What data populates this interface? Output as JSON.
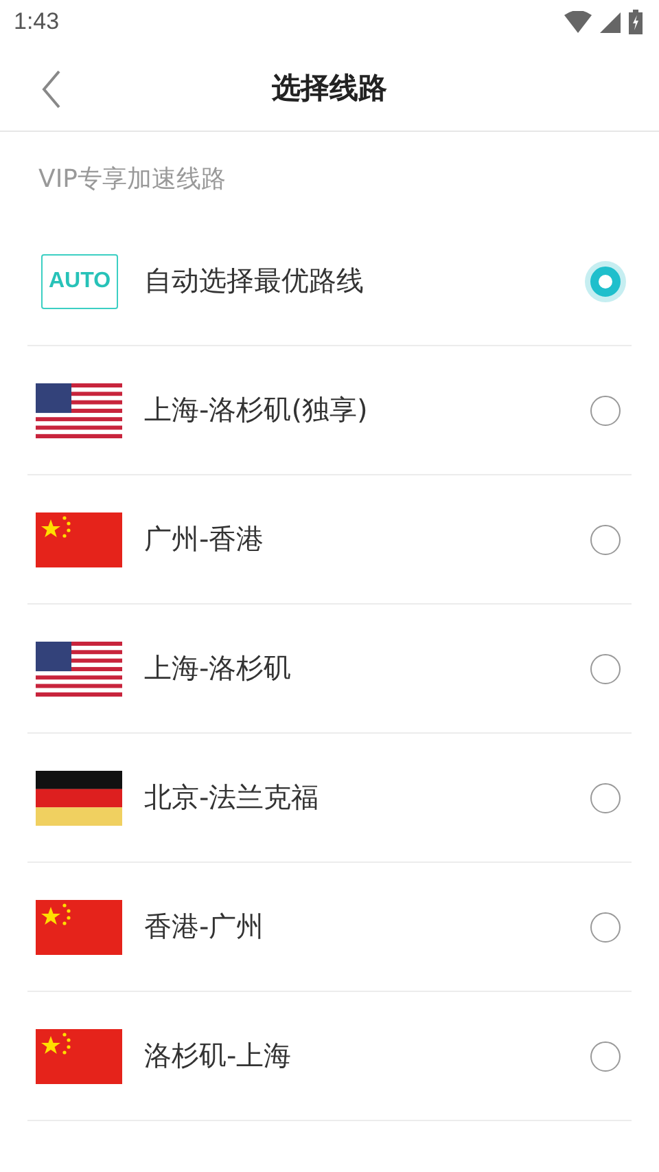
{
  "status_bar": {
    "time": "1:43"
  },
  "header": {
    "title": "选择线路"
  },
  "section": {
    "title": "VIP专享加速线路"
  },
  "routes": [
    {
      "kind": "auto",
      "badge": "AUTO",
      "name": "自动选择最优路线",
      "selected": true
    },
    {
      "kind": "us",
      "name": "上海-洛杉矶(独享)",
      "selected": false
    },
    {
      "kind": "cn",
      "name": "广州-香港",
      "selected": false
    },
    {
      "kind": "us",
      "name": "上海-洛杉矶",
      "selected": false
    },
    {
      "kind": "de",
      "name": "北京-法兰克福",
      "selected": false
    },
    {
      "kind": "cn",
      "name": "香港-广州",
      "selected": false
    },
    {
      "kind": "cn",
      "name": "洛杉矶-上海",
      "selected": false
    }
  ]
}
